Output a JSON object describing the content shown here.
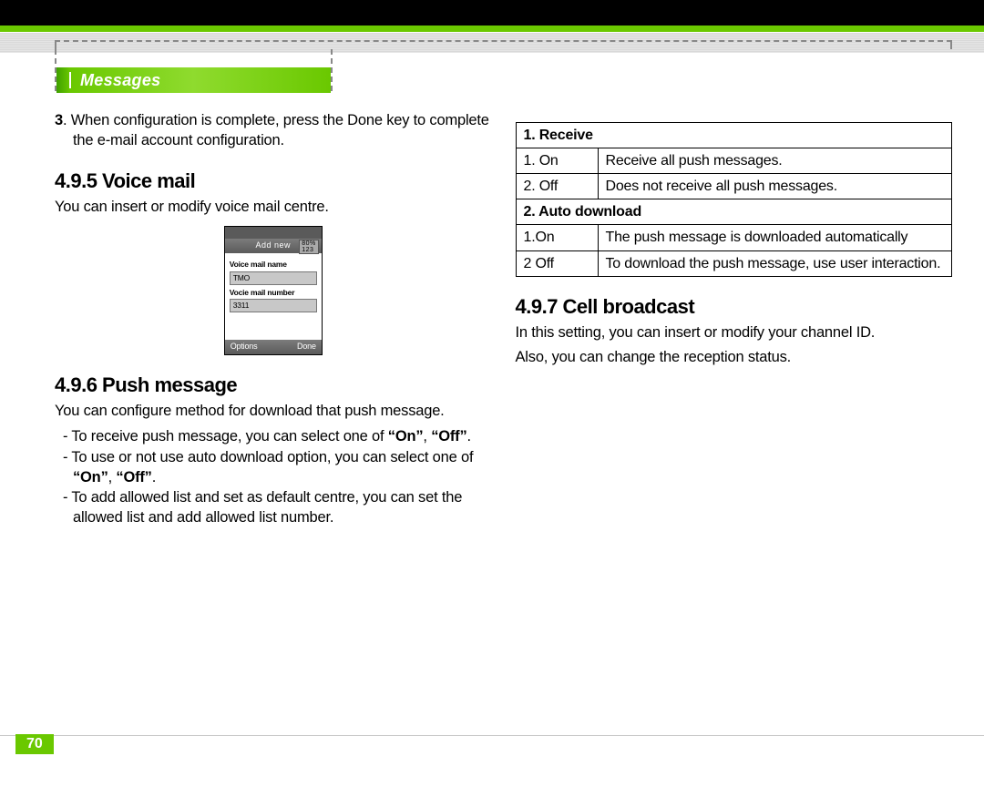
{
  "section_tab": "Messages",
  "page_number": "70",
  "left": {
    "step3": {
      "num": "3",
      "text": ". When configuration is complete, press the Done key to complete the e-mail account configuration."
    },
    "h_voice": "4.9.5 Voice mail",
    "voice_desc": "You can insert or modify voice mail centre.",
    "phone": {
      "title": "Add new",
      "badge_top": "80%",
      "badge_bot": "123",
      "lbl_name": "Voice mail name",
      "val_name": "TMO",
      "lbl_number": "Vocie mail number",
      "val_number": "3311",
      "soft_left": "Options",
      "soft_right": "Done"
    },
    "h_push": "4.9.6 Push message",
    "push_desc": "You can configure method for download that push message.",
    "push_b1a": "- To receive push message, you can select one of ",
    "push_b1_strong": "“On”",
    "push_b1_mid": ", ",
    "push_b1_strong2": "“Off”",
    "push_b1_end": ".",
    "push_b2a": "- To use or not use auto download option, you can select one of ",
    "push_b2_strong": "“On”",
    "push_b2_mid": ", ",
    "push_b2_strong2": "“Off”",
    "push_b2_end": ".",
    "push_b3": "- To add allowed list and set as default centre, you can set the allowed list and add allowed list number."
  },
  "right": {
    "tbl": {
      "h1": "1. Receive",
      "r1c1": "1. On",
      "r1c2": "Receive all push messages.",
      "r2c1": "2. Off",
      "r2c2": "Does not receive all push messages.",
      "h2": "2. Auto download",
      "r3c1": "1.On",
      "r3c2": "The push message is downloaded automatically",
      "r4c1": "2 Off",
      "r4c2": "To download the push message, use user interaction."
    },
    "h_cell": "4.9.7 Cell broadcast",
    "cell_p1": "In this setting, you can insert or modify your channel ID.",
    "cell_p2": "Also, you can change the reception status."
  }
}
